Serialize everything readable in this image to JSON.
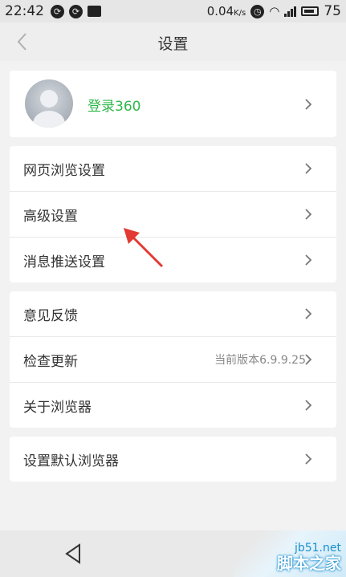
{
  "status_bar": {
    "time": "22:42",
    "network_speed": "0.04",
    "network_unit": "K/s",
    "battery": "75"
  },
  "header": {
    "title": "设置"
  },
  "account": {
    "login_label": "登录360"
  },
  "groups": [
    {
      "items": [
        {
          "label": "网页浏览设置"
        },
        {
          "label": "高级设置"
        },
        {
          "label": "消息推送设置"
        }
      ]
    },
    {
      "items": [
        {
          "label": "意见反馈"
        },
        {
          "label": "检查更新",
          "value": "当前版本6.9.9.25"
        },
        {
          "label": "关于浏览器"
        }
      ]
    },
    {
      "items": [
        {
          "label": "设置默认浏览器"
        }
      ]
    }
  ],
  "watermark": {
    "url": "jb51.net",
    "name": "脚本之家"
  },
  "colors": {
    "accent_green": "#2fb84a",
    "annotation_red": "#e23a33"
  }
}
